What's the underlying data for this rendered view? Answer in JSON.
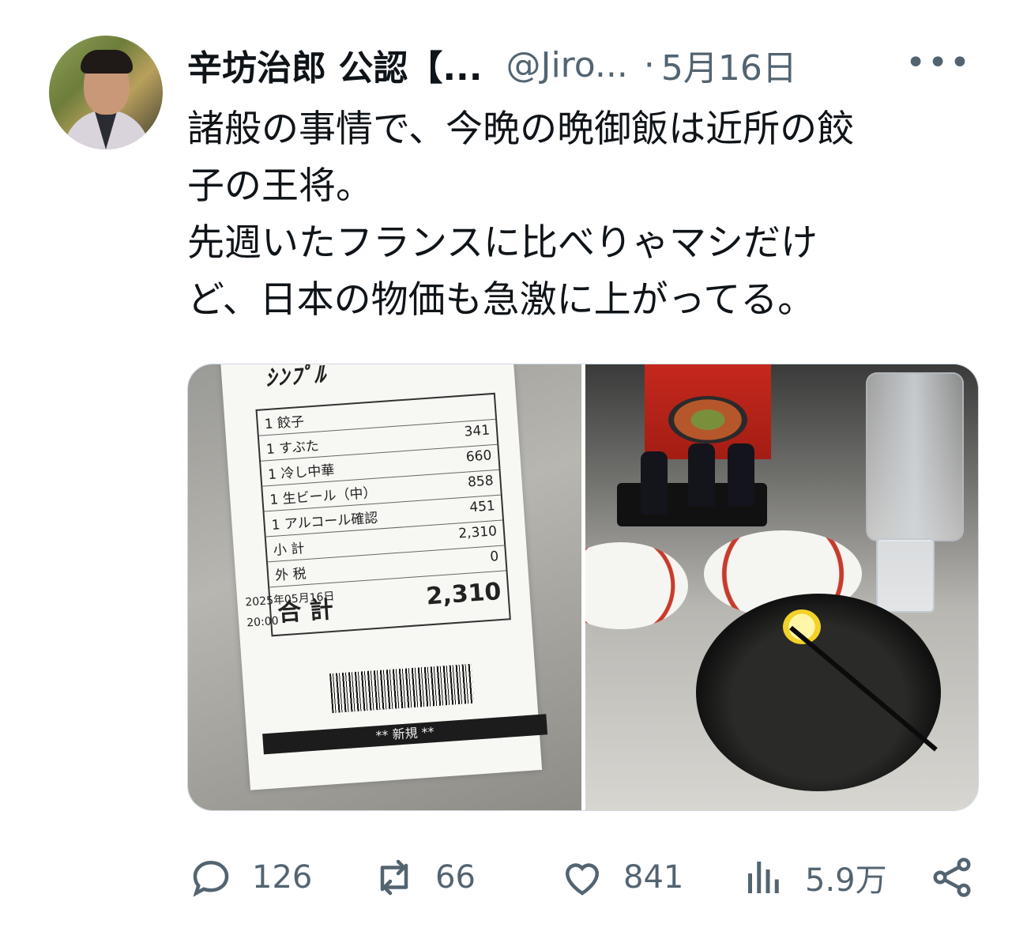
{
  "tweet": {
    "author": {
      "display_name": "辛坊治郎 公認【...",
      "handle": "@Jiro...",
      "separator": "·",
      "date": "5月16日"
    },
    "more_label": "•••",
    "text_lines": [
      "諸般の事情で、今晩の晩御飯は近所の餃",
      "子の王将。",
      "先週いたフランスに比べりゃマシだけ",
      "ど、日本の物価も急激に上がってる。"
    ],
    "receipt": {
      "items": [
        {
          "name": "餃子",
          "qty": "1",
          "price": ""
        },
        {
          "name": "すぶた",
          "qty": "1",
          "price": "341"
        },
        {
          "name": "冷し中華",
          "qty": "1",
          "price": "660"
        },
        {
          "name": "生ビール（中）",
          "qty": "1",
          "price": "858"
        },
        {
          "name": "アルコール確認",
          "qty": "1",
          "price": "451"
        }
      ],
      "subtotal": "2,310",
      "tax": "0",
      "total": "2,310",
      "date": "2025年05月16日",
      "time": "20:00",
      "banner": "** 新規 **"
    },
    "metrics": {
      "replies": "126",
      "reposts": "66",
      "likes": "841",
      "views": "5.9万"
    },
    "icons": {
      "reply": "reply-icon",
      "repost": "repost-icon",
      "like": "like-icon",
      "views": "views-icon",
      "share": "share-icon"
    },
    "colors": {
      "text": "#0f1419",
      "secondary": "#536471",
      "border": "#cfd9de"
    }
  }
}
